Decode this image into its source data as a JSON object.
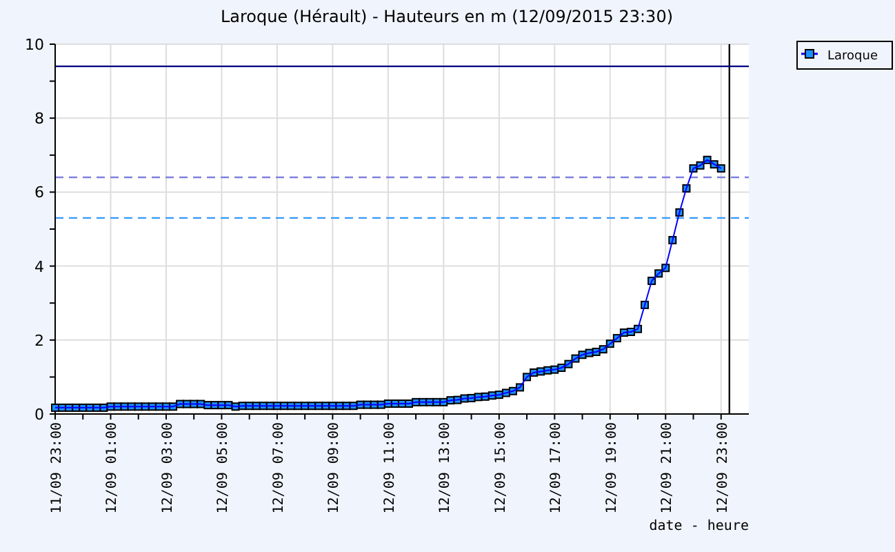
{
  "chart": {
    "chart_data": {
      "type": "line",
      "title": "Laroque (Hérault) - Hauteurs en m (12/09/2015 23:30)",
      "xlabel": "date - heure",
      "categories": [
        "11/09 23:00",
        null,
        null,
        null,
        null,
        null,
        null,
        null,
        "12/09 01:00",
        null,
        null,
        null,
        null,
        null,
        null,
        null,
        "12/09 03:00",
        null,
        null,
        null,
        null,
        null,
        null,
        null,
        "12/09 05:00",
        null,
        null,
        null,
        null,
        null,
        null,
        null,
        "12/09 07:00",
        null,
        null,
        null,
        null,
        null,
        null,
        null,
        "12/09 09:00",
        null,
        null,
        null,
        null,
        null,
        null,
        null,
        "12/09 11:00",
        null,
        null,
        null,
        null,
        null,
        null,
        null,
        "12/09 13:00",
        null,
        null,
        null,
        null,
        null,
        null,
        null,
        "12/09 15:00",
        null,
        null,
        null,
        null,
        null,
        null,
        null,
        "12/09 17:00",
        null,
        null,
        null,
        null,
        null,
        null,
        null,
        "12/09 19:00",
        null,
        null,
        null,
        null,
        null,
        null,
        null,
        "12/09 21:00",
        null,
        null,
        null,
        null,
        null,
        null,
        null,
        "12/09 23:00"
      ],
      "series": [
        {
          "name": "Laroque",
          "color": "#0000ff",
          "marker": "square",
          "values": [
            0.17,
            0.17,
            0.17,
            0.17,
            0.17,
            0.17,
            0.17,
            0.17,
            0.2,
            0.2,
            0.2,
            0.2,
            0.2,
            0.2,
            0.2,
            0.2,
            0.2,
            0.2,
            0.27,
            0.27,
            0.27,
            0.27,
            0.24,
            0.24,
            0.24,
            0.24,
            0.2,
            0.22,
            0.22,
            0.22,
            0.22,
            0.22,
            0.22,
            0.22,
            0.22,
            0.22,
            0.22,
            0.22,
            0.22,
            0.22,
            0.22,
            0.22,
            0.22,
            0.22,
            0.25,
            0.25,
            0.25,
            0.25,
            0.28,
            0.28,
            0.28,
            0.28,
            0.32,
            0.32,
            0.32,
            0.32,
            0.32,
            0.37,
            0.38,
            0.42,
            0.43,
            0.46,
            0.47,
            0.5,
            0.52,
            0.57,
            0.62,
            0.72,
            1.0,
            1.12,
            1.15,
            1.18,
            1.2,
            1.25,
            1.35,
            1.5,
            1.6,
            1.65,
            1.68,
            1.75,
            1.9,
            2.05,
            2.2,
            2.22,
            2.3,
            2.95,
            3.6,
            3.8,
            3.95,
            4.7,
            5.45,
            6.1,
            6.64,
            6.72,
            6.87,
            6.75,
            6.64
          ]
        }
      ],
      "ylim": [
        0,
        10
      ],
      "yticks": [
        0,
        2,
        4,
        6,
        8,
        10
      ],
      "grid": true,
      "ref_lines": [
        {
          "axis": "y",
          "value": 9.4,
          "color": "#000080"
        },
        {
          "axis": "y",
          "value": 6.4,
          "color": "#8080e0"
        },
        {
          "axis": "y",
          "value": 5.3,
          "color": "#3399ff"
        }
      ]
    }
  }
}
